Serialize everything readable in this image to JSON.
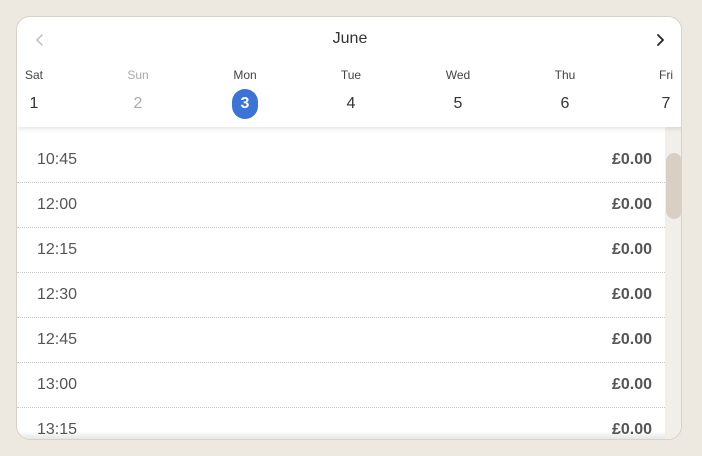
{
  "calendar": {
    "month": "June",
    "prev_icon": "chevron-left-icon",
    "next_icon": "chevron-right-icon",
    "accent_color": "#3c73d6",
    "days": [
      {
        "name": "Sat",
        "num": "1",
        "state": "normal"
      },
      {
        "name": "Sun",
        "num": "2",
        "state": "disabled"
      },
      {
        "name": "Mon",
        "num": "3",
        "state": "selected"
      },
      {
        "name": "Tue",
        "num": "4",
        "state": "normal"
      },
      {
        "name": "Wed",
        "num": "5",
        "state": "normal"
      },
      {
        "name": "Thu",
        "num": "6",
        "state": "normal"
      },
      {
        "name": "Fri",
        "num": "7",
        "state": "normal"
      }
    ]
  },
  "slots": [
    {
      "time": "10:45",
      "price": "£0.00"
    },
    {
      "time": "12:00",
      "price": "£0.00"
    },
    {
      "time": "12:15",
      "price": "£0.00"
    },
    {
      "time": "12:30",
      "price": "£0.00"
    },
    {
      "time": "12:45",
      "price": "£0.00"
    },
    {
      "time": "13:00",
      "price": "£0.00"
    },
    {
      "time": "13:15",
      "price": "£0.00"
    }
  ]
}
